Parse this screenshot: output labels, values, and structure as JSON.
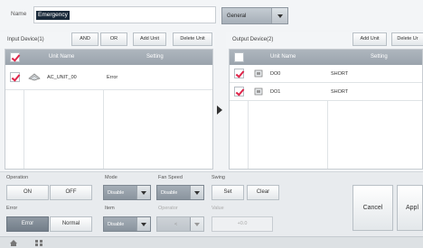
{
  "header": {
    "name_label": "Name",
    "name_value": "Emergency",
    "type_selected": "General"
  },
  "input_panel": {
    "title": "Input Device(1)",
    "buttons": [
      "AND",
      "OR",
      "Add Unit",
      "Delete Unit"
    ],
    "columns": [
      "Unit Name",
      "Setting"
    ],
    "rows": [
      {
        "name": "AC_UNIT_00",
        "setting": "Error",
        "checked": true,
        "icon": "ac-unit-icon"
      }
    ]
  },
  "output_panel": {
    "title": "Output Device(2)",
    "buttons": [
      "Add Unit",
      "Delete Ur"
    ],
    "columns": [
      "Unit Name",
      "Setting"
    ],
    "rows": [
      {
        "name": "DO0",
        "setting": "SHORT",
        "checked": true,
        "icon": "do-device-icon"
      },
      {
        "name": "DO1",
        "setting": "SHORT",
        "checked": true,
        "icon": "do-device-icon"
      }
    ]
  },
  "controls": {
    "operation_label": "Operation",
    "on": "ON",
    "off": "OFF",
    "mode_label": "Mode",
    "mode_value": "Disable",
    "fan_label": "Fan Speed",
    "fan_value": "Disable",
    "swing_label": "Swing",
    "set": "Set",
    "clear": "Clear",
    "error_label": "Error",
    "error_btn": "Error",
    "normal_btn": "Normal",
    "item_label": "Item",
    "item_value": "Disable",
    "operator_label": "Operator",
    "operator_value": "<",
    "value_label": "Value",
    "value_value": "+0.0",
    "cancel": "Cancel",
    "apply": "Appl"
  },
  "colors": {
    "check": "#e0254a",
    "header": "#9aa3ac",
    "active_segment": "#7d8893"
  }
}
